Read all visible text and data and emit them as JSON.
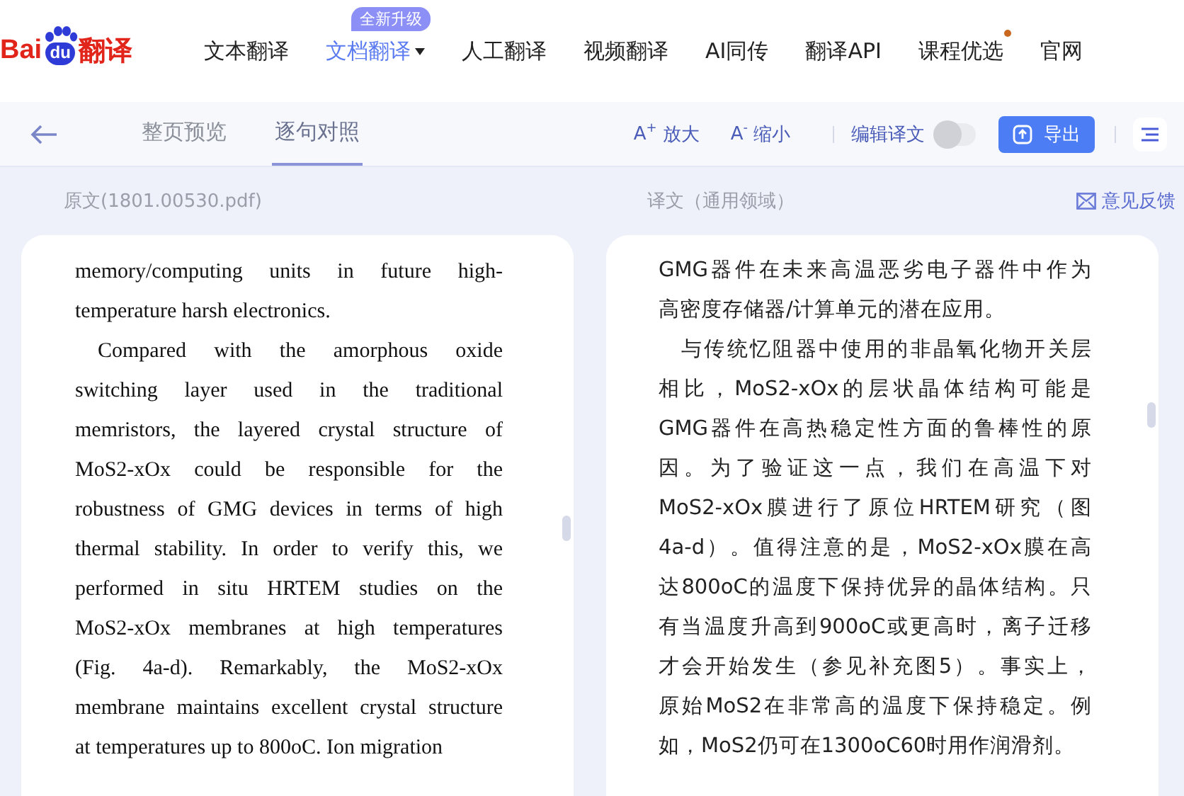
{
  "logo": {
    "part_1": "Bai",
    "part_2": "du",
    "part_3": "翻译"
  },
  "nav": [
    {
      "label": "文本翻译",
      "selected": false
    },
    {
      "label": "文档翻译",
      "selected": true,
      "badge": "全新升级",
      "dropdown": true
    },
    {
      "label": "人工翻译",
      "selected": false
    },
    {
      "label": "视频翻译",
      "selected": false
    },
    {
      "label": "AI同传",
      "selected": false
    },
    {
      "label": "翻译API",
      "selected": false
    },
    {
      "label": "课程优选",
      "selected": false,
      "dot": true
    },
    {
      "label": "官网",
      "selected": false
    }
  ],
  "toolbar": {
    "view_tabs": [
      {
        "label": "整页预览",
        "selected": false
      },
      {
        "label": "逐句对照",
        "selected": true
      }
    ],
    "zoom_in": {
      "icon": "A",
      "sup": "+",
      "label": "放大"
    },
    "zoom_out": {
      "icon": "A",
      "sup": "-",
      "label": "缩小"
    },
    "edit_toggle": {
      "label": "编辑译文",
      "on": false
    },
    "export": {
      "label": "导出"
    }
  },
  "source": {
    "header": "原文(1801.00530.pdf)",
    "paragraphs": [
      {
        "indented": false,
        "lines": [
          "memory/computing units in future high-",
          "temperature harsh electronics."
        ]
      },
      {
        "indented": true,
        "lines": [
          "Compared with the amorphous oxide",
          "switching layer used in the traditional",
          "memristors, the layered crystal structure of",
          "MoS2-xOx could be responsible for the",
          "robustness of GMG devices in terms of high",
          "thermal stability. In order to verify this, we",
          "performed in situ HRTEM studies on the",
          "MoS2-xOx membranes at high temperatures",
          "(Fig. 4a-d). Remarkably, the MoS2-xOx",
          "membrane maintains excellent crystal structure",
          "at temperatures up to 800oC. Ion migration"
        ]
      }
    ]
  },
  "translation": {
    "header": "译文（通用领域）",
    "feedback": "意见反馈",
    "paragraphs": [
      {
        "indented": false,
        "lines": [
          "GMG器件在未来高温恶劣电子器件中作为",
          "高密度存储器/计算单元的潜在应用。"
        ]
      },
      {
        "indented": true,
        "lines": [
          "与传统忆阻器中使用的非晶氧化物开关层",
          "相比，MoS2-xOx的层状晶体结构可能是",
          "GMG器件在高热稳定性方面的鲁棒性的原",
          "因。为了验证这一点，我们在高温下对",
          "MoS2-xOx膜进行了原位HRTEM研究（图",
          "4a-d）。值得注意的是，MoS2-xOx膜在高",
          "达800oC的温度下保持优异的晶体结构。只",
          "有当温度升高到900oC或更高时，离子迁移",
          "才会开始发生（参见补充图5）。事实上，",
          "原始MoS2在非常高的温度下保持稳定。例",
          "如，MoS2仍可在1300oC60时用作润滑剂。"
        ]
      }
    ]
  }
}
